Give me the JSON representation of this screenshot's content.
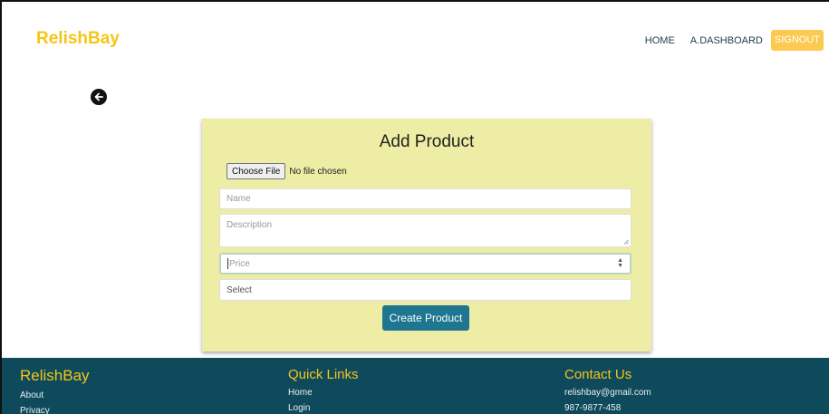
{
  "navbar": {
    "brand": "RelishBay",
    "links": [
      "HOME",
      "A.DASHBOARD"
    ],
    "signout_label": "SIGNOUT"
  },
  "form": {
    "title": "Add Product",
    "file_button": "Choose File",
    "file_status": "No file chosen",
    "name_placeholder": "Name",
    "description_placeholder": "Description",
    "price_placeholder": "Price",
    "category_value": "Select",
    "submit_label": "Create Product"
  },
  "footer": {
    "brand": "RelishBay",
    "brand_links": [
      "About",
      "Privacy"
    ],
    "quick_links_title": "Quick Links",
    "quick_links": [
      "Home",
      "Login"
    ],
    "contact_title": "Contact Us",
    "contact": [
      "relishbay@gmail.com",
      "987-9877-458"
    ]
  },
  "colors": {
    "brand": "#f5c518",
    "card_bg": "#eeeda6",
    "button": "#1e7690",
    "footer_bg": "#0e4a5b",
    "signout_bg": "#fcc951"
  },
  "icons": {
    "back": "arrow-left-circle-icon"
  }
}
